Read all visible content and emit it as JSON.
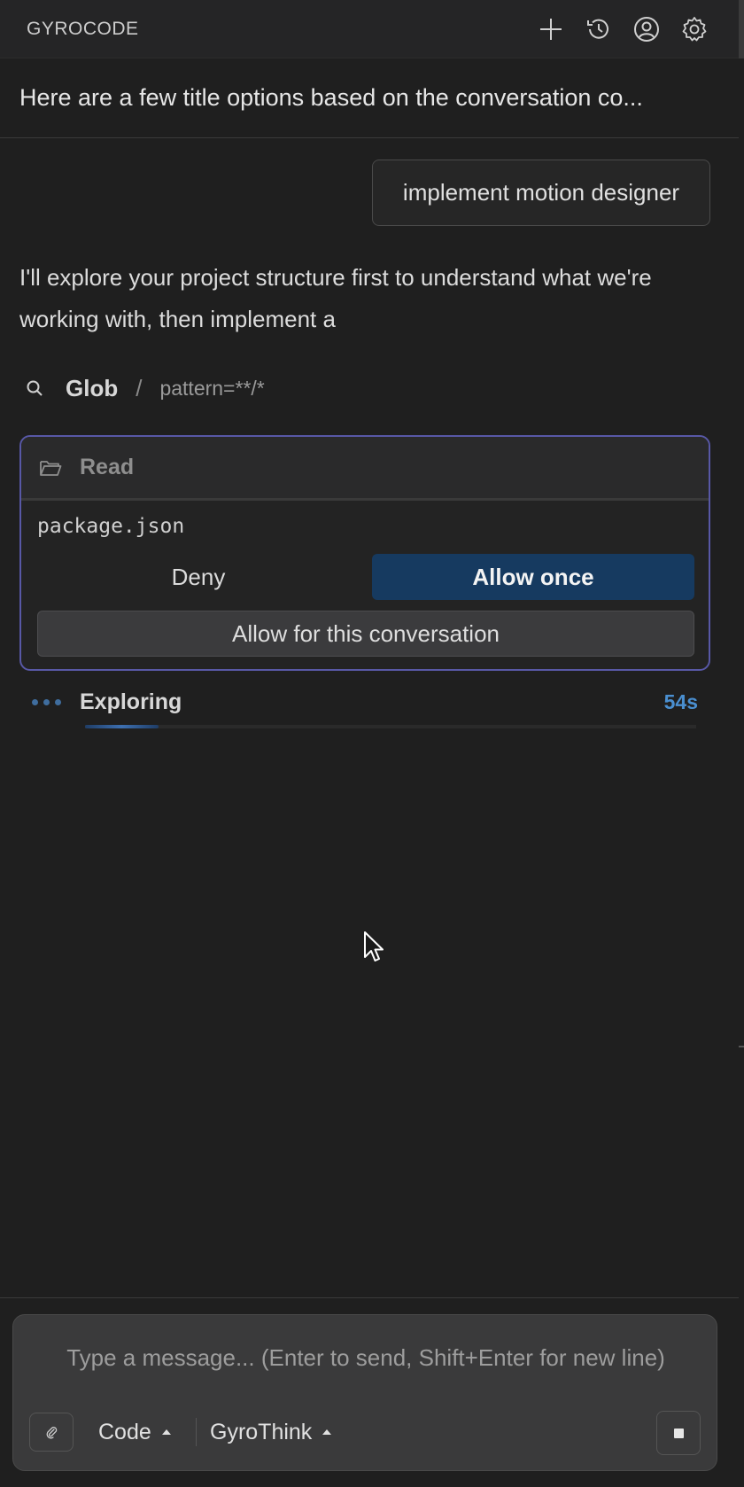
{
  "app": {
    "brand": "GYROCODE"
  },
  "header": {
    "icons": [
      "plus-icon",
      "history-icon",
      "account-icon",
      "gear-icon"
    ]
  },
  "conversation": {
    "title": "Here are a few title options based on the conversation co..."
  },
  "messages": {
    "user": "implement motion designer",
    "assistant": "I'll explore your project structure first to understand what we're working with, then implement a"
  },
  "tool_call": {
    "name": "Glob",
    "separator": "/",
    "args": "pattern=**/*"
  },
  "permission": {
    "tool": "Read",
    "file": "package.json",
    "deny_label": "Deny",
    "allow_once_label": "Allow once",
    "allow_conversation_label": "Allow for this conversation"
  },
  "status": {
    "label": "Exploring",
    "elapsed": "54s",
    "progress": 0.12
  },
  "composer": {
    "placeholder": "Type a message... (Enter to send, Shift+Enter for new line)",
    "value": "",
    "mode": "Code",
    "model": "GyroThink"
  },
  "colors": {
    "accent": "#163a60",
    "card_border": "#5858a6",
    "time": "#4a8fd0"
  }
}
